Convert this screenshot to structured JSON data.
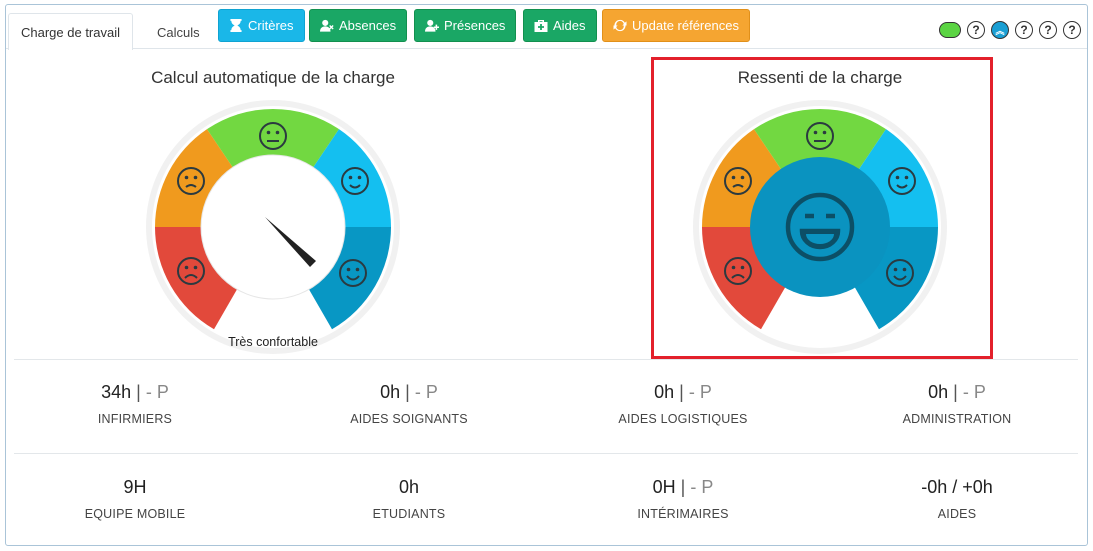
{
  "tabs": [
    {
      "label": "Charge de travail",
      "active": true
    },
    {
      "label": "Calculs",
      "active": false
    }
  ],
  "toolbar": {
    "criteres": "Critères",
    "absences": "Absences",
    "presences": "Présences",
    "aides": "Aides",
    "update": "Update références"
  },
  "right_icons": {
    "status_color": "#5bd443",
    "help_glyph": "?",
    "scroll_top_glyph": "︽"
  },
  "gauge_auto": {
    "title": "Calcul automatique de la charge",
    "caption": "Très confortable",
    "segment_colors": [
      "#e2493b",
      "#f09a1e",
      "#72d841",
      "#14bff0",
      "#0897c4"
    ]
  },
  "gauge_ressenti": {
    "title": "Ressenti de la charge",
    "center_color": "#0a93c0"
  },
  "stats": [
    {
      "value": "34h",
      "suffix": "- P",
      "label": "INFIRMIERS"
    },
    {
      "value": "0h",
      "suffix": "- P",
      "label": "AIDES SOIGNANTS"
    },
    {
      "value": "0h",
      "suffix": "- P",
      "label": "AIDES LOGISTIQUES"
    },
    {
      "value": "0h",
      "suffix": "- P",
      "label": "ADMINISTRATION"
    },
    {
      "value": "9H",
      "suffix": "",
      "label": "EQUIPE MOBILE"
    },
    {
      "value": "0h",
      "suffix": "",
      "label": "ETUDIANTS"
    },
    {
      "value": "0H",
      "suffix": "- P",
      "label": "INTÉRIMAIRES"
    },
    {
      "value": "-0h / +0h",
      "suffix": "",
      "label": "AIDES"
    }
  ]
}
